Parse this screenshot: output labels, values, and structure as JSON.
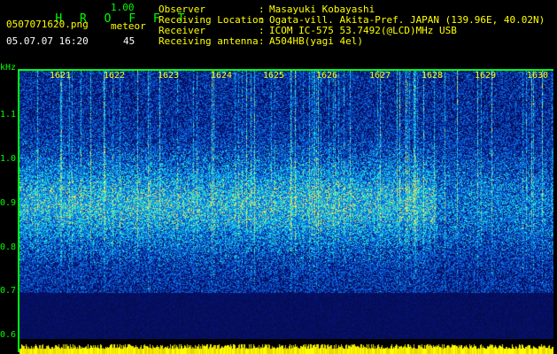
{
  "header": {
    "brand": "H R O F F T",
    "version": "1.00",
    "filename": "0507071620.png",
    "meteor_label": "meteor",
    "datetime": "05.07.07 16:20",
    "meteor_count": "45"
  },
  "info": [
    {
      "key": "Observer",
      "value": "Masayuki Kobayashi"
    },
    {
      "key": "Receiving Location",
      "value": "Ogata-vill. Akita-Pref. JAPAN (139.96E, 40.02N)"
    },
    {
      "key": "Receiver",
      "value": "ICOM IC-575 53.7492(@LCD)MHz USB"
    },
    {
      "key": "Receiving antenna",
      "value": "A504HB(yagi 4el)"
    }
  ],
  "plot": {
    "y_unit": "kHz",
    "y_ticks": [
      "1.1",
      "1.0",
      "0.9",
      "0.8",
      "0.7",
      "0.6"
    ],
    "x_ticks": [
      "1621",
      "1622",
      "1623",
      "1624",
      "1625",
      "1626",
      "1627",
      "1628",
      "1629",
      "1630"
    ]
  },
  "colors": {
    "background": "#000000",
    "label_green": "#00ff00",
    "label_yellow": "#ffff00",
    "spectrogram_base": "#0a1460"
  }
}
